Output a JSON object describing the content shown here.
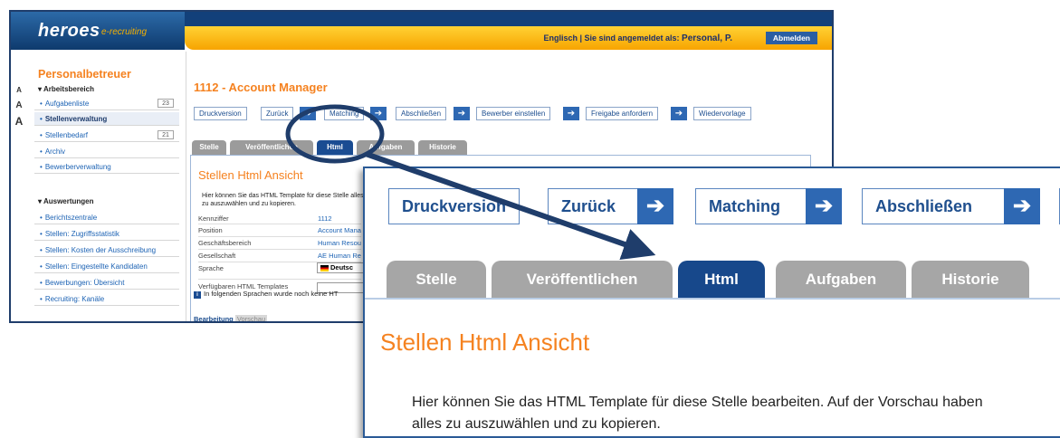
{
  "header": {
    "logo": "heroes",
    "logo_sub": "e-recruiting",
    "user_info_prefix": "Englisch  |  Sie sind angemeldet als:",
    "user_name": "Personal, P.",
    "logout_label": "Abmelden"
  },
  "font_size": [
    "A",
    "A",
    "A"
  ],
  "sidebar": {
    "title": "Personalbetreuer",
    "section1": "Arbeitsbereich",
    "items1": [
      {
        "label": "Aufgabenliste",
        "count": "23"
      },
      {
        "label": "Stellenverwaltung"
      },
      {
        "label": "Stellenbedarf",
        "count": "21"
      },
      {
        "label": "Archiv"
      },
      {
        "label": "Bewerberverwaltung"
      }
    ],
    "section2": "Auswertungen",
    "items2": [
      {
        "label": "Berichtszentrale"
      },
      {
        "label": "Stellen: Zugriffsstatistik"
      },
      {
        "label": "Stellen: Kosten der Ausschreibung"
      },
      {
        "label": "Stellen: Eingestellte Kandidaten"
      },
      {
        "label": "Bewerbungen: Übersicht"
      },
      {
        "label": "Recruiting: Kanäle"
      }
    ]
  },
  "main": {
    "title": "1112 - Account Manager",
    "toolbar": [
      "Druckversion",
      "Zurück",
      "Matching",
      "Abschließen",
      "Bewerber einstellen",
      "Freigabe anfordern",
      "Wiedervorlage"
    ],
    "tabs": [
      "Stelle",
      "Veröffentlichen",
      "Html",
      "Aufgaben",
      "Historie"
    ],
    "panel_title": "Stellen Html Ansicht",
    "description_small": "Hier können Sie das HTML Template für diese Stelle alles zu auszuwählen und zu kopieren.",
    "fields": [
      {
        "label": "Kennziffer",
        "value": "1112"
      },
      {
        "label": "Position",
        "value": "Account Mana"
      },
      {
        "label": "Geschäftsbereich",
        "value": "Human Resou"
      },
      {
        "label": "Gesellschaft",
        "value": "AE Human Re"
      },
      {
        "label": "Sprache",
        "value": "Deutsc"
      },
      {
        "label": "Verfügbaren HTML Templates",
        "value": ""
      }
    ],
    "info_text": "In folgenden Sprachen wurde noch keine HT",
    "subtabs": [
      "Bearbeitung",
      "Vorschau"
    ]
  },
  "zoom": {
    "toolbar": [
      "Druckversion",
      "Zurück",
      "Matching",
      "Abschließen"
    ],
    "tabs": [
      "Stelle",
      "Veröffentlichen",
      "Html",
      "Aufgaben",
      "Historie"
    ],
    "panel_title": "Stellen Html Ansicht",
    "description_line1": "Hier können Sie das HTML Template für diese Stelle bearbeiten. Auf der Vorschau haben",
    "description_line2": "alles zu auszuwählen und zu kopieren."
  },
  "colors": {
    "accent_orange": "#f58220",
    "brand_blue": "#1a4c92",
    "tab_inactive": "#9b9b9b"
  }
}
